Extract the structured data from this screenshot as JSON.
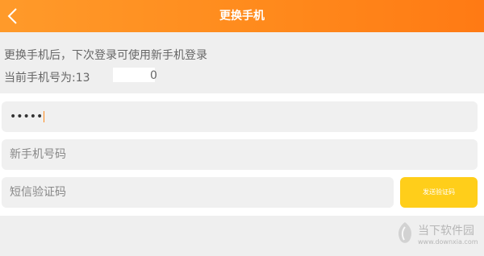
{
  "header": {
    "title": "更换手机",
    "back_icon": "chevron-left-icon",
    "gradient_start": "#ff9a2a",
    "gradient_end": "#ff7a14"
  },
  "info": {
    "line1": "更换手机后，下次登录可使用新手机登录",
    "line2_prefix": "当前手机号为:13",
    "line2_suffix": "0"
  },
  "form": {
    "password_value": "•••••",
    "new_phone_placeholder": "新手机号码",
    "sms_code_placeholder": "短信验证码",
    "send_code_label": "发送验证码",
    "send_button_color": "#ffce1a"
  },
  "watermark": {
    "name": "当下软件园",
    "url": "www.downxia.com"
  }
}
